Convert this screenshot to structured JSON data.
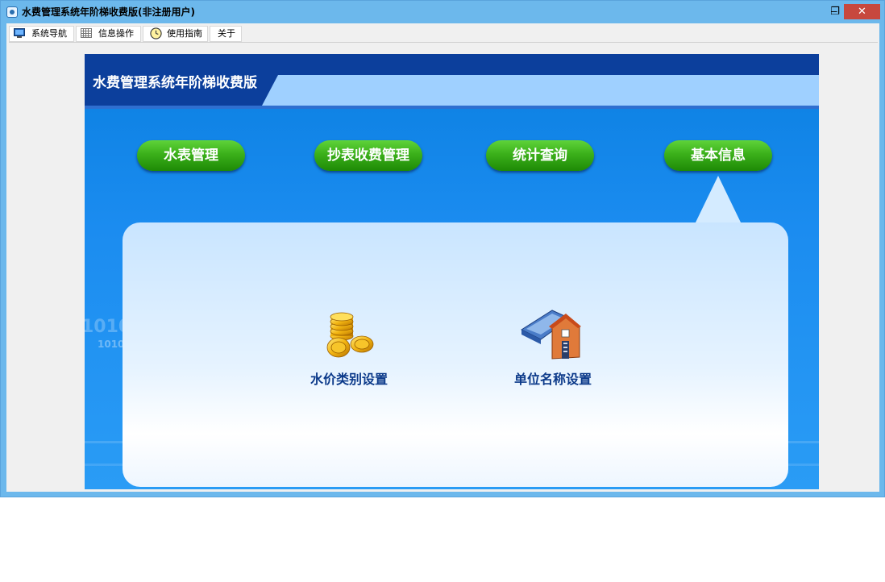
{
  "window": {
    "title": "水费管理系统年阶梯收费版(非注册用户)",
    "controls": {
      "minimize": "‒",
      "restore": "❐",
      "close": "✕"
    }
  },
  "menu": [
    {
      "label": "系统导航",
      "icon": "monitor-icon"
    },
    {
      "label": "信息操作",
      "icon": "grid-icon"
    },
    {
      "label": "使用指南",
      "icon": "clock-icon"
    },
    {
      "label": "关于",
      "icon": ""
    }
  ],
  "header": {
    "title": "水费管理系统年阶梯收费版"
  },
  "nav_buttons": [
    "水表管理",
    "抄表收费管理",
    "统计查询",
    "基本信息"
  ],
  "panel_items": [
    {
      "label": "水价类别设置",
      "icon": "gold-coins-icon"
    },
    {
      "label": "单位名称设置",
      "icon": "house-book-icon"
    }
  ],
  "background_text": [
    "1010",
    "1010"
  ]
}
